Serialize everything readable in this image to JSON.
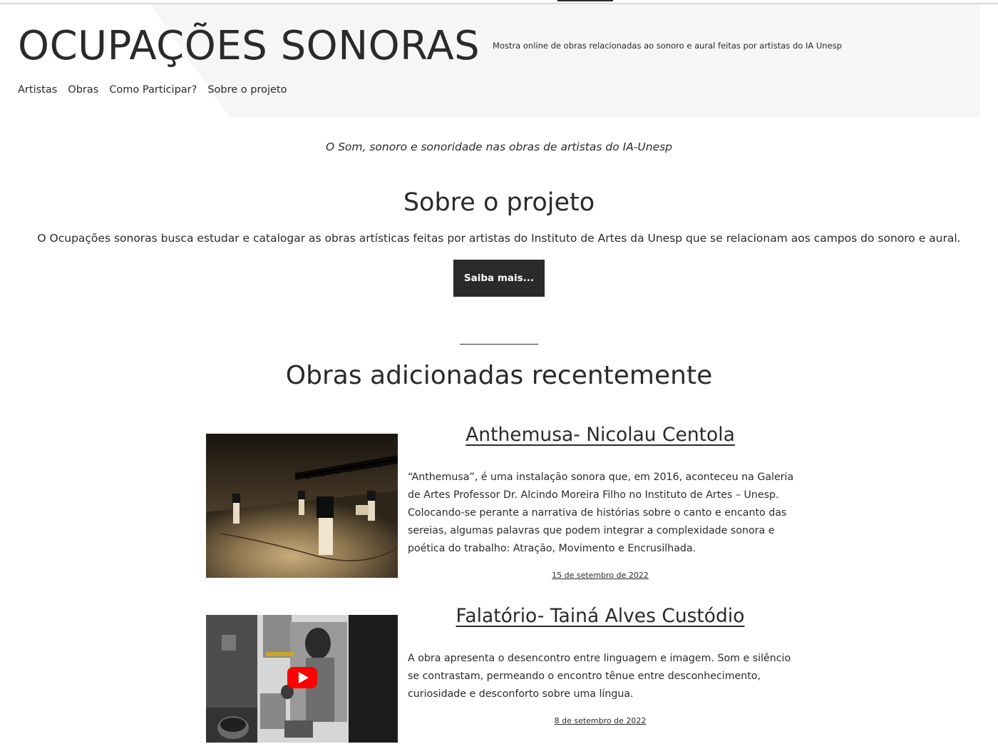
{
  "site": {
    "title": "OCUPAÇÕES SONORAS",
    "description": "Mostra online de obras relacionadas ao sonoro e aural feitas por artistas do IA Unesp"
  },
  "nav": {
    "items": [
      {
        "label": "Artistas"
      },
      {
        "label": "Obras"
      },
      {
        "label": "Como Participar?"
      },
      {
        "label": "Sobre o projeto"
      }
    ]
  },
  "tagline": "O Som, sonoro e sonoridade nas obras de artistas do IA-Unesp",
  "about": {
    "heading": "Sobre o projeto",
    "text": "O Ocupações sonoras busca estudar e catalogar as obras artísticas feitas por artistas do Instituto de Artes da Unesp que se relacionam aos campos do sonoro e aural.",
    "button_label": "Saiba mais..."
  },
  "recent": {
    "heading": "Obras adicionadas recentemente",
    "posts": [
      {
        "title": "Anthemusa- Nicolau Centola",
        "excerpt": "“Anthemusa”, é uma instalação sonora que, em 2016, aconteceu na Galeria de Artes Professor Dr. Alcindo Moreira Filho no Instituto de Artes – Unesp. Colocando-se perante a narrativa de histórias sobre o canto e encanto das sereias, algumas palavras que podem integrar a complexidade sonora e poética do trabalho: Atração, Movimento e Encrusilhada.",
        "date": "15 de setembro de 2022"
      },
      {
        "title": "Falatório- Tainá Alves Custódio",
        "excerpt": "A obra apresenta o desencontro entre linguagem e imagem. Som e silêncio se contrastam, permeando o encontro tênue entre desconhecimento, curiosidade e desconforto sobre uma língua.",
        "date": "8 de setembro de 2022"
      }
    ]
  },
  "colors": {
    "text": "#2a2a2a",
    "header_bg": "#f6f6f6",
    "button_bg": "#2a2a2a",
    "button_text": "#ffffff",
    "youtube_red": "#ff0000"
  }
}
